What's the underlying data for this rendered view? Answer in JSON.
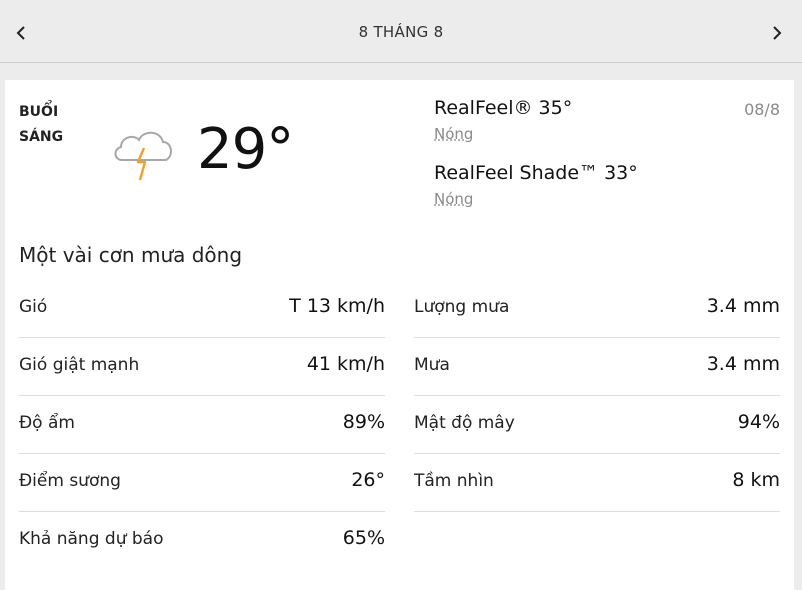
{
  "header": {
    "title": "8 THÁNG 8",
    "prev_icon": "chevron-left-icon",
    "next_icon": "chevron-right-icon"
  },
  "summary": {
    "period": "BUỔI SÁNG",
    "icon": "thunderstorm-cloud-icon",
    "temperature": "29°",
    "date": "08/8",
    "realfeel": "RealFeel® 35°",
    "realfeel_desc": "Nóng",
    "realfeel_shade": "RealFeel Shade™ 33°",
    "realfeel_shade_desc": "Nóng",
    "phrase": "Một vài cơn mưa dông"
  },
  "details_left": [
    {
      "label": "Gió",
      "value": "T 13 km/h"
    },
    {
      "label": "Gió giật mạnh",
      "value": "41 km/h"
    },
    {
      "label": "Độ ẩm",
      "value": "89%"
    },
    {
      "label": "Điểm sương",
      "value": "26°"
    },
    {
      "label": "Khả năng dự báo",
      "value": "65%"
    }
  ],
  "details_right": [
    {
      "label": "Lượng mưa",
      "value": "3.4 mm"
    },
    {
      "label": "Mưa",
      "value": "3.4 mm"
    },
    {
      "label": "Mật độ mây",
      "value": "94%"
    },
    {
      "label": "Tầm nhìn",
      "value": "8 km"
    }
  ],
  "colors": {
    "background": "#ececec",
    "card": "#ffffff",
    "cloud": "#a8a8a8",
    "bolt": "#f0a030",
    "muted_text": "#8a8a8a"
  }
}
